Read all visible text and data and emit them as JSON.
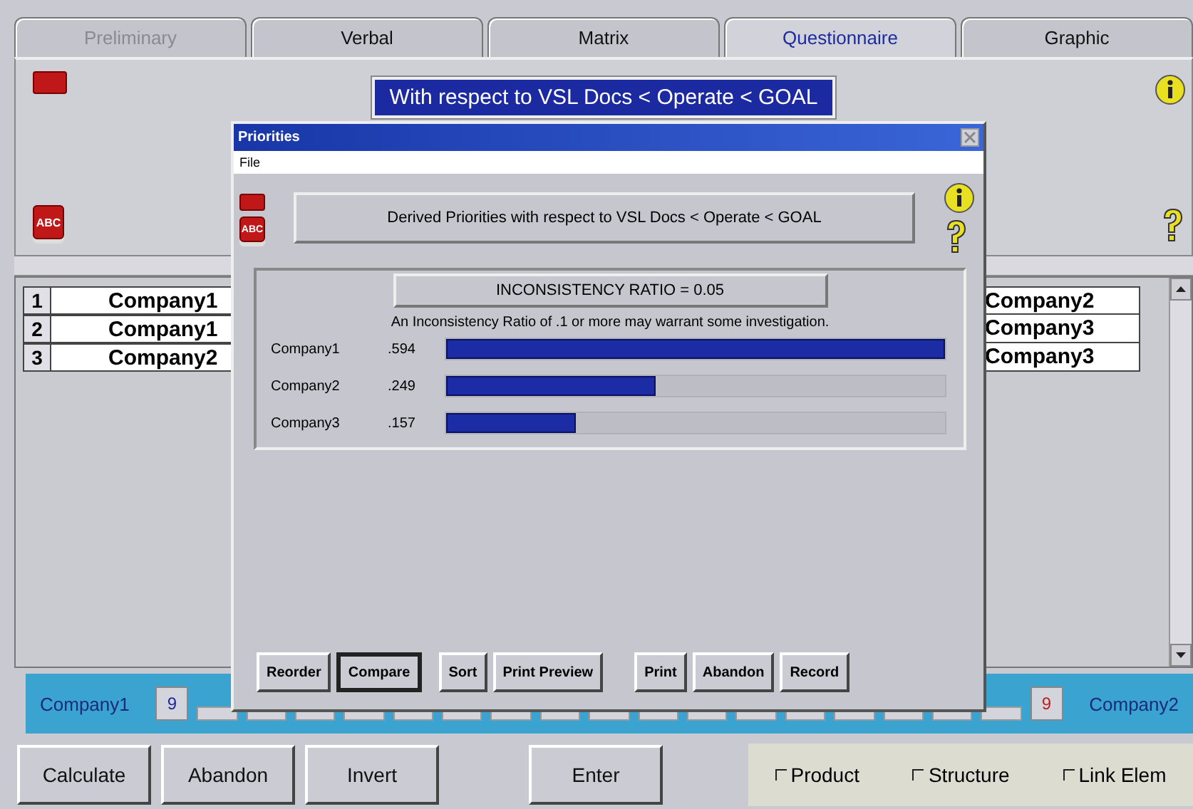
{
  "tabs": [
    {
      "label": "Preliminary",
      "selected": false,
      "disabled": true
    },
    {
      "label": "Verbal",
      "selected": false,
      "disabled": false
    },
    {
      "label": "Matrix",
      "selected": false,
      "disabled": false
    },
    {
      "label": "Questionnaire",
      "selected": true,
      "disabled": false
    },
    {
      "label": "Graphic",
      "selected": false,
      "disabled": false
    }
  ],
  "header": {
    "title": "With respect to VSL Docs < Operate < GOAL",
    "abc_icon": "ABC"
  },
  "left_list": [
    {
      "index": "1",
      "name": "Company1"
    },
    {
      "index": "2",
      "name": "Company1"
    },
    {
      "index": "3",
      "name": "Company2"
    }
  ],
  "right_list": [
    "Company2",
    "Company3",
    "Company3"
  ],
  "scale": {
    "left_name": "Company1",
    "values": [
      {
        "text": "9",
        "color": "#1a2a9a"
      },
      {
        "text": "9",
        "color": "#c0201a"
      }
    ],
    "right_name": "Company2"
  },
  "buttons": [
    "Calculate",
    "Abandon",
    "Invert",
    "Enter"
  ],
  "options": [
    {
      "label": "Product",
      "checked": false
    },
    {
      "label": "Structure",
      "checked": false
    },
    {
      "label": "Link Elem",
      "checked": false
    }
  ],
  "dialog": {
    "title": "Priorities",
    "menu": [
      "File"
    ],
    "abc_icon": "ABC",
    "heading": "Derived Priorities with respect to VSL Docs < Operate < GOAL",
    "ratio": "INCONSISTENCY RATIO = 0.05",
    "note": "An Inconsistency Ratio of .1 or more may warrant some investigation.",
    "priorities": [
      {
        "name": "Company1",
        "value": ".594",
        "level": 1
      },
      {
        "name": "Company2",
        "value": ".249",
        "level": 0.42
      },
      {
        "name": "Company3",
        "value": ".157",
        "level": 0.26
      }
    ],
    "buttons": [
      {
        "label": "Reorder",
        "default": false
      },
      {
        "label": "Compare",
        "default": true
      },
      {
        "label": "Sort",
        "default": false
      },
      {
        "label": "Print Preview",
        "default": false
      },
      {
        "label": "Print",
        "default": false
      },
      {
        "label": "Abandon",
        "default": false
      },
      {
        "label": "Record",
        "default": false
      }
    ]
  }
}
